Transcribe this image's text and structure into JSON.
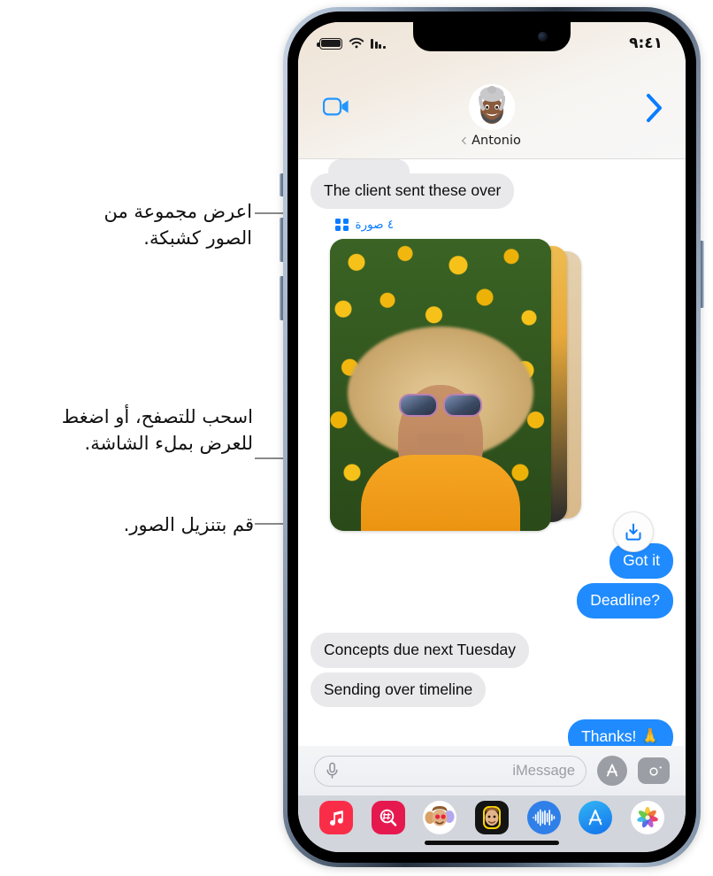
{
  "callouts": [
    {
      "id": "grid-callout",
      "text": "اعرض مجموعة من الصور كشبكة."
    },
    {
      "id": "swipe-callout",
      "text": "اسحب للتصفح، أو اضغط للعرض بملء الشاشة."
    },
    {
      "id": "download-callout",
      "text": "قم بتنزيل الصور."
    }
  ],
  "status_bar": {
    "time": "٩:٤١",
    "battery_icon": "battery-icon",
    "wifi_icon": "wifi-icon",
    "cellular_icon": "cellular-bars-icon"
  },
  "nav": {
    "facetime_icon": "facetime-video-icon",
    "forward_icon": "chevron-right-icon",
    "back_chevron_icon": "chevron-left-icon",
    "contact_name": "Antonio",
    "avatar_icon": "memoji-avatar"
  },
  "thread": {
    "messages": [
      {
        "text": "The client sent these over",
        "side": "in",
        "tail": false
      },
      {
        "text": "Got it",
        "side": "out",
        "tail": false
      },
      {
        "text": "Deadline?",
        "side": "out",
        "tail": true
      },
      {
        "text": "Concepts due next Tuesday",
        "side": "in",
        "tail": false
      },
      {
        "text": "Sending over timeline",
        "side": "in",
        "tail": true
      },
      {
        "text": "Thanks! 🙏",
        "side": "out",
        "tail": false
      }
    ]
  },
  "photo_stack": {
    "count_label": "٤ صورة",
    "grid_icon": "grid-2x2-icon",
    "download_icon": "download-tray-icon",
    "accent_color": "#0a7cff"
  },
  "input_bar": {
    "mic_icon": "microphone-icon",
    "placeholder": "iMessage",
    "appstore_icon": "app-store-icon",
    "camera_icon": "camera-icon"
  },
  "dock": {
    "apps": [
      {
        "name": "music-app",
        "icon": "music-note-icon",
        "color": "#fa2d48"
      },
      {
        "name": "images-app",
        "icon": "hash-search-icon",
        "color": "#e6194f"
      },
      {
        "name": "memoji-stickers",
        "icon": "memoji-sticker-icon",
        "color": "#ffffff"
      },
      {
        "name": "memoji-app",
        "icon": "memoji-face-icon",
        "color": "#1c1c1e"
      },
      {
        "name": "digital-touch",
        "icon": "waveform-icon",
        "color": "#2f7fe8"
      },
      {
        "name": "app-store",
        "icon": "app-store-icon",
        "color": "#1e9bf0"
      },
      {
        "name": "photos-app",
        "icon": "photos-flower-icon",
        "color": "#ffffff"
      }
    ]
  },
  "colors": {
    "imessage_blue": "#1f8bff",
    "bubble_gray": "#e9e9eb",
    "accent_blue": "#0a7cff",
    "dock_bg": "#d2d5dc"
  }
}
